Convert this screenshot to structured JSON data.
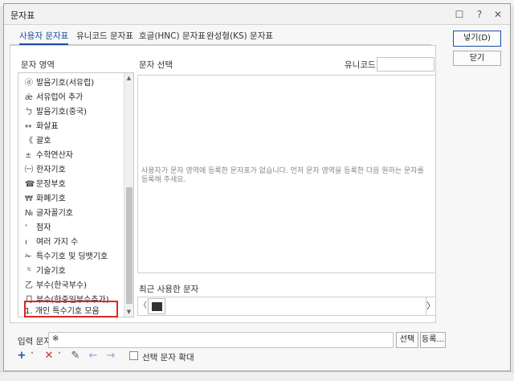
{
  "window": {
    "title": "문자표",
    "help_icon": "?",
    "close_icon": "✕",
    "msg_icon": "☐"
  },
  "tabs": [
    {
      "label": "사용자 문자표"
    },
    {
      "label": "유니코드 문자표"
    },
    {
      "label": "호글(HNC) 문자표"
    },
    {
      "label": "완성형(KS) 문자표"
    }
  ],
  "labels": {
    "char_area": "문자 영역",
    "char_select": "문자 선택",
    "unicode": "유니코드",
    "recent": "최근 사용한 문자",
    "input_char": "입력 문자",
    "expand_checkbox": "선택 문자 확대"
  },
  "categories": [
    {
      "sym": "ⓓ",
      "label": "발음기호(서유럽)"
    },
    {
      "sym": "ǽ",
      "label": "서유럽어 추가"
    },
    {
      "sym": "ㄅ",
      "label": "발음기호(중국)"
    },
    {
      "sym": "↔",
      "label": "화살표"
    },
    {
      "sym": "《",
      "label": "괄호"
    },
    {
      "sym": "±",
      "label": "수학연산자"
    },
    {
      "sym": "㈠",
      "label": "한자기호"
    },
    {
      "sym": "☎",
      "label": "문장부호"
    },
    {
      "sym": "₩",
      "label": "화폐기호"
    },
    {
      "sym": "№",
      "label": "글자꼴기호"
    },
    {
      "sym": "'",
      "label": "점자"
    },
    {
      "sym": "ı",
      "label": "여러 가지 수"
    },
    {
      "sym": "✁",
      "label": "특수기호 및 딩뱃기호"
    },
    {
      "sym": "⺀",
      "label": "기술기호"
    },
    {
      "sym": "乙",
      "label": "부수(한국부수)"
    },
    {
      "sym": "⺆",
      "label": "부수(한중일부수추가)"
    },
    {
      "sym": "",
      "label": "1. 개인 특수기호 모음"
    }
  ],
  "preview_message": "사용자가 문자 영역에 등록한 문자표가 없습니다. 먼저 문자 영역을 등록한 다음 원하는 문자를 등록해 주세요.",
  "input": {
    "value": "※"
  },
  "buttons": {
    "insert": "넣기(D)",
    "close": "닫기",
    "select": "선택",
    "register": "등록..."
  },
  "toolbar": {
    "add": "+",
    "dropdown": "˅",
    "delete": "✕",
    "edit": "✎",
    "prev": "←",
    "next": "→"
  },
  "scroll": {
    "up": "▲",
    "down": "▼",
    "left": "〈",
    "right": "〉"
  }
}
